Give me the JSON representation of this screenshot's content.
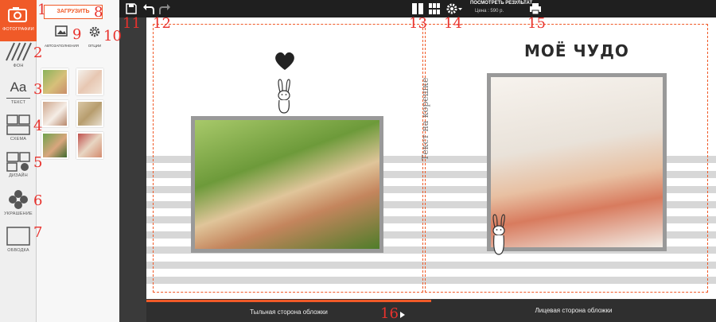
{
  "left_tools": [
    {
      "name": "tool-photos",
      "label": "ФОТОГРАФИИ",
      "icon": "photos-icon"
    },
    {
      "name": "tool-background",
      "label": "ФОН",
      "icon": "background-pattern-icon"
    },
    {
      "name": "tool-text",
      "label": "ТЕКСТ",
      "icon": "text-icon",
      "glyph": "Aa"
    },
    {
      "name": "tool-layout",
      "label": "СХЕМА",
      "icon": "layout-icon"
    },
    {
      "name": "tool-design",
      "label": "ДИЗАЙН",
      "icon": "design-icon"
    },
    {
      "name": "tool-decoration",
      "label": "УКРАШЕНИЕ",
      "icon": "decoration-icon"
    },
    {
      "name": "tool-border",
      "label": "ОБВОДКА",
      "icon": "border-icon"
    }
  ],
  "panel": {
    "upload_label": "ЗАГРУЗИТЬ",
    "autofill_label": "АВТОЗАПОЛНЕНИЯ",
    "options_label": "ОПЦИИ"
  },
  "topbar": {
    "preview_label": "ПОСМОТРЕТЬ РЕЗУЛЬТАТ",
    "price_label": "Цена :   590 р."
  },
  "canvas": {
    "spine_text": "Текст на корешке",
    "cover_title": "МОЁ ЧУДО"
  },
  "bottombar": {
    "back_cover_label": "Тыльная сторона обложки",
    "front_cover_label": "Лицевая сторона обложки"
  },
  "annotations": [
    "1",
    "2",
    "3",
    "4",
    "5",
    "6",
    "7",
    "8",
    "9",
    "10",
    "11",
    "12",
    "13",
    "14",
    "15",
    "16"
  ],
  "colors": {
    "accent": "#f05a28",
    "annotation": "#e8322d",
    "stripe": "#d7d7d7"
  }
}
